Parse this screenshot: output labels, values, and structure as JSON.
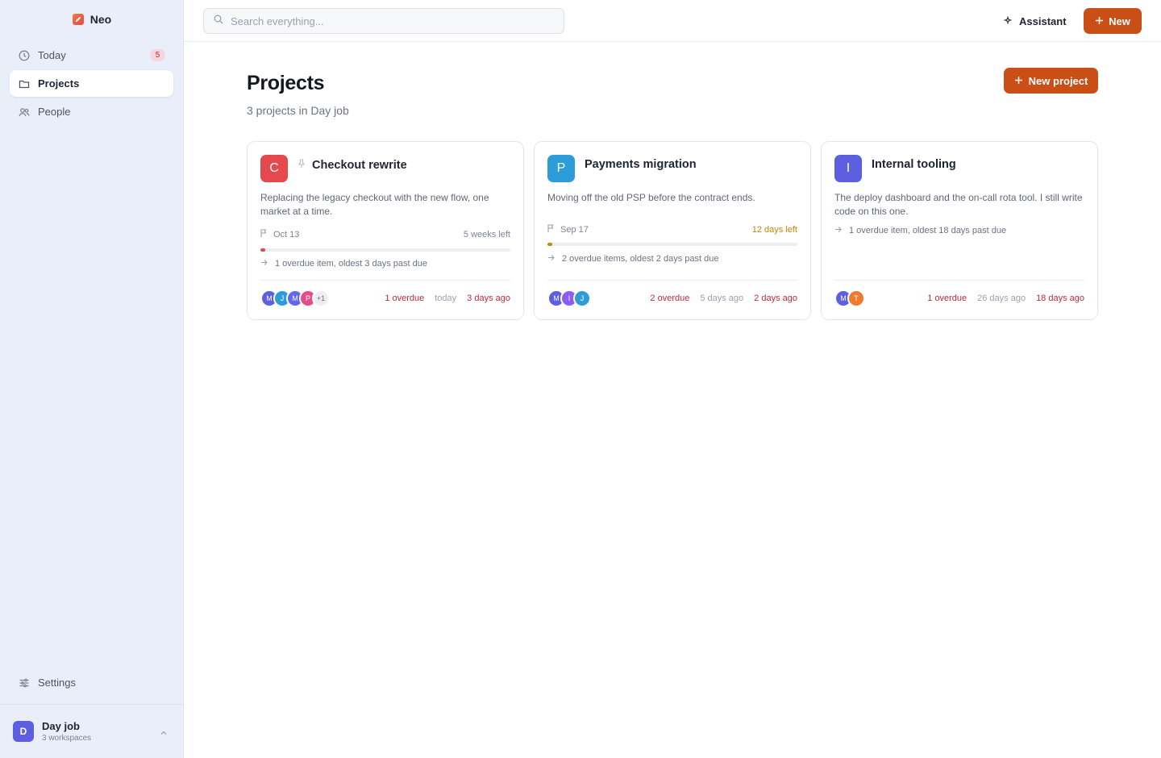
{
  "app": {
    "name": "Neo"
  },
  "sidebar": {
    "items": [
      {
        "label": "Today",
        "icon": "clock-icon",
        "badge": "5"
      },
      {
        "label": "Projects",
        "icon": "folder-icon",
        "active": true
      },
      {
        "label": "People",
        "icon": "people-icon"
      }
    ],
    "settings_label": "Settings",
    "workspace": {
      "initial": "D",
      "name": "Day job",
      "sub": "3 workspaces"
    }
  },
  "topbar": {
    "search_placeholder": "Search everything...",
    "assistant_label": "Assistant",
    "new_label": "New"
  },
  "main": {
    "title": "Projects",
    "subtitle": "3 projects in Day job",
    "new_project_label": "New project",
    "projects": [
      {
        "initial": "C",
        "color": "#e5484d",
        "pinned": true,
        "name": "Checkout rewrite",
        "description": "Replacing the legacy checkout with the new flow, one market at a time.",
        "due": "Oct 13",
        "time_left": "5 weeks left",
        "progress_fraction": 0.02,
        "overdue_note": "1 overdue item, oldest 3 days past due",
        "members": [
          "M",
          "J",
          "M",
          "P"
        ],
        "more_members": "+1",
        "overdue": "1 overdue",
        "updated": "today",
        "last": "3 days ago"
      },
      {
        "initial": "P",
        "color": "#2d9cdb",
        "pinned": false,
        "name": "Payments migration",
        "description": "Moving off the old PSP before the contract ends.",
        "due": "Sep 17",
        "time_left": "12 days left",
        "progress_fraction": 0.02,
        "overdue_note": "2 overdue items, oldest 2 days past due",
        "members": [
          "M",
          "I",
          "J"
        ],
        "overdue": "2 overdue",
        "updated": "5 days ago",
        "last": "2 days ago"
      },
      {
        "initial": "I",
        "color": "#5b5fe0",
        "pinned": false,
        "name": "Internal tooling",
        "description": "The deploy dashboard and the on-call rota tool. I still write code on this one.",
        "overdue_note": "1 overdue item, oldest 18 days past due",
        "members": [
          "M",
          "T"
        ],
        "overdue": "1 overdue",
        "updated": "26 days ago",
        "last": "18 days ago"
      }
    ]
  },
  "colors": {
    "accent": "#c94f16",
    "danger": "#c5283d",
    "warning": "#c2870a",
    "sidebar_bg": "#e9eef8"
  }
}
